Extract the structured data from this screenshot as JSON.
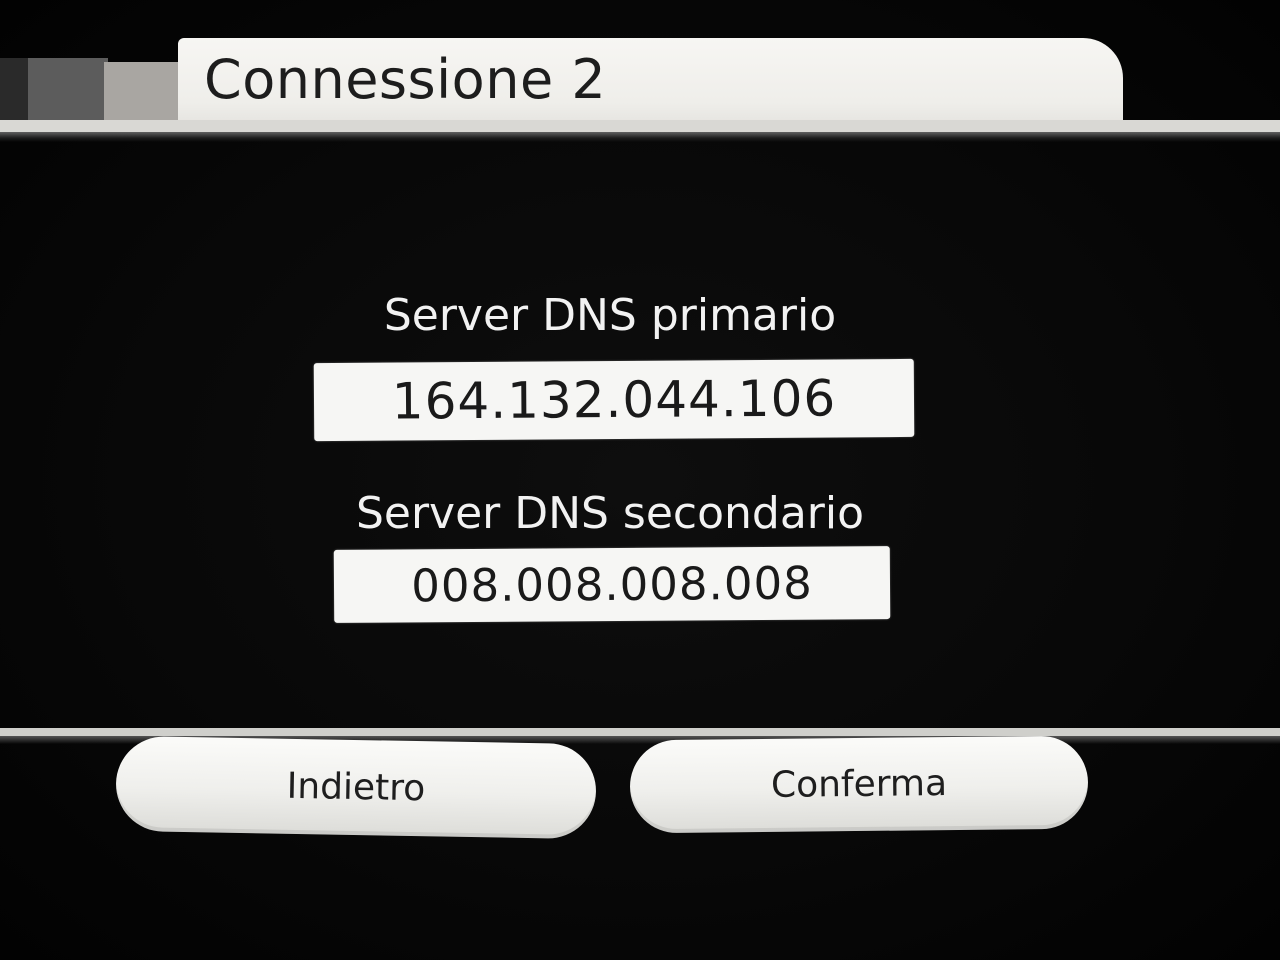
{
  "header": {
    "title": "Connessione 2"
  },
  "dns": {
    "primary_label": "Server DNS primario",
    "primary_value": "164.132.044.106",
    "secondary_label": "Server DNS secondario",
    "secondary_value": "008.008.008.008"
  },
  "footer": {
    "back_label": "Indietro",
    "confirm_label": "Conferma"
  },
  "colors": {
    "background": "#080808",
    "panel": "#f6f6f4",
    "text_dark": "#1a1a1a",
    "text_light": "#f2f2f2"
  }
}
